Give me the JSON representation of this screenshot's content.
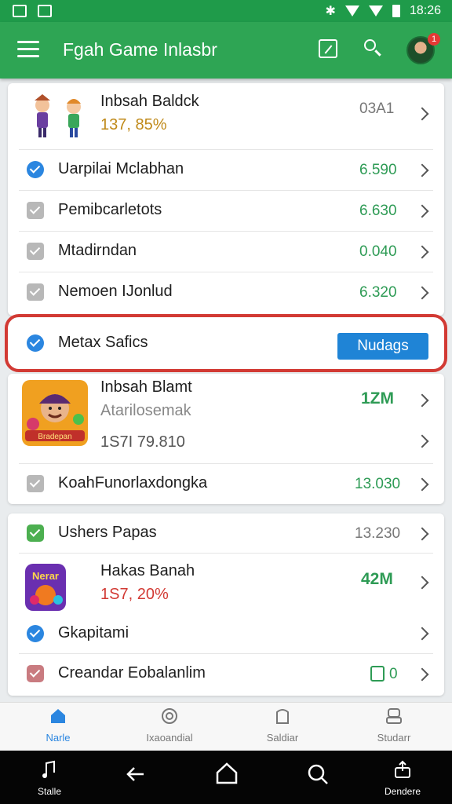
{
  "status_bar": {
    "time": "18:26"
  },
  "app_bar": {
    "title": "Fgah Game Inlasbr",
    "badge_count": "1"
  },
  "card1": {
    "header": {
      "title": "Inbsah Baldck",
      "subtitle": "137, 85%",
      "value": "03A1"
    },
    "rows": [
      {
        "label": "Uarpilai Mclabhan",
        "value": "6.590",
        "check": "blue"
      },
      {
        "label": "Pemibcarletots",
        "value": "6.630",
        "check": "gray"
      },
      {
        "label": "Mtadirndan",
        "value": "0.040",
        "check": "gray"
      },
      {
        "label": "Nemoen IJonlud",
        "value": "6.320",
        "check": "gray"
      }
    ]
  },
  "highlight_row": {
    "label": "Metax Safics",
    "button": "Nudags"
  },
  "card2": {
    "game": {
      "title": "Inbsah Blamt",
      "subtitle": "Atarilosemak",
      "stat": "1S7I 79.810",
      "value": "1ZM",
      "thumb_label": "Bradepan"
    },
    "row": {
      "label": "KoahFunorlaxdongka",
      "value": "13.030"
    }
  },
  "card3": {
    "row1": {
      "label": "Ushers Papas",
      "value": "13.230"
    },
    "game": {
      "title": "Hakas Banah",
      "percent": "1S7, 20%",
      "value": "42M",
      "thumb_label": "Nerar"
    },
    "row2": {
      "label": "Gkapitami"
    },
    "row3": {
      "label": "Creandar Eobalanlim",
      "value": "0"
    }
  },
  "bottom_nav": [
    {
      "label": "Narle",
      "active": true
    },
    {
      "label": "Ixaoandial",
      "active": false
    },
    {
      "label": "Saldiar",
      "active": false
    },
    {
      "label": "Studarr",
      "active": false
    }
  ],
  "system_nav": {
    "left_label": "Stalle",
    "right_label": "Dendere"
  },
  "colors": {
    "primary": "#2ea554",
    "accent_blue": "#1f84d6",
    "highlight_red": "#d23a34",
    "value_green": "#2e9b55"
  }
}
